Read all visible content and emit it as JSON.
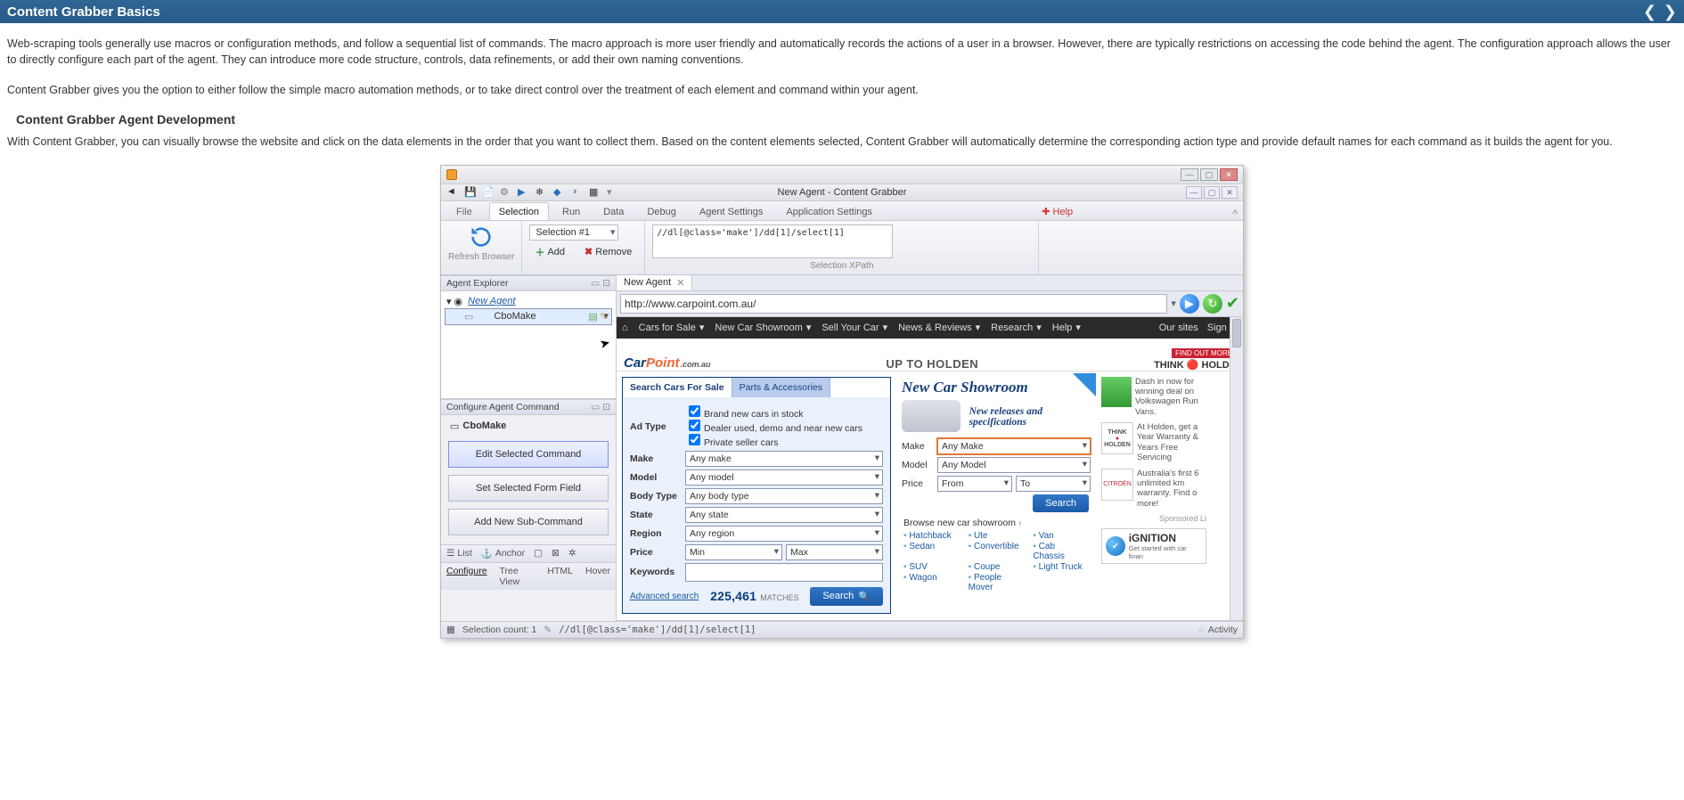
{
  "header": {
    "title": "Content Grabber Basics"
  },
  "paragraphs": {
    "p1": "Web-scraping tools generally use macros or configuration methods, and follow a sequential list of commands. The macro approach is more user friendly and automatically records the actions of a user in a browser. However, there are typically restrictions on accessing the code behind the agent. The configuration approach allows the user to directly configure each part of the agent. They can introduce more code structure, controls, data refinements, or add their own naming conventions.",
    "p2": "Content Grabber gives you the option to either follow the simple macro automation methods, or to take direct control over the treatment of each element and command within your agent.",
    "h2": "Content Grabber Agent Development",
    "p3": "With Content Grabber, you can visually browse the website and click on the data elements in the order that you want to collect them. Based on the content elements selected, Content Grabber will automatically determine the corresponding action type and provide default names for each command as it builds the agent for you."
  },
  "app": {
    "qa_title": "New Agent - Content Grabber",
    "tabs": {
      "file": "File",
      "selection": "Selection",
      "run": "Run",
      "data": "Data",
      "debug": "Debug",
      "agent_settings": "Agent Settings",
      "app_settings": "Application Settings",
      "help": "Help"
    },
    "refresh": "Refresh Browser",
    "selection_combo": "Selection #1",
    "add": "Add",
    "remove": "Remove",
    "xpath": "//dl[@class='make']/dd[1]/select[1]",
    "xpath_label": "Selection XPath",
    "explorer": {
      "title": "Agent Explorer",
      "root": "New Agent",
      "child": "CboMake"
    },
    "configure": {
      "title": "Configure Agent Command",
      "cmd": "CboMake",
      "b1": "Edit Selected Command",
      "b2": "Set Selected Form Field",
      "b3": "Add New Sub-Command"
    },
    "toolrow": {
      "list": "List",
      "anchor": "Anchor"
    },
    "tabrow": {
      "configure": "Configure",
      "tree": "Tree View",
      "html": "HTML",
      "hover": "Hover"
    },
    "doc_tab": "New Agent",
    "url": "http://www.carpoint.com.au/",
    "status_count": "Selection count: 1",
    "status_xpath": "//dl[@class='make']/dd[1]/select[1]",
    "activity": "Activity"
  },
  "site": {
    "nav": {
      "cars": "Cars for Sale",
      "new": "New Car Showroom",
      "sell": "Sell Your Car",
      "news": "News & Reviews",
      "research": "Research",
      "help": "Help",
      "our": "Our sites",
      "sign": "Sign In"
    },
    "banner_mid": "UP TO HOLDEN",
    "banner_r": "THINK 🔴 HOLDE",
    "banner_find": "FIND OUT MORE",
    "search": {
      "t1": "Search Cars For Sale",
      "t2": "Parts & Accessories",
      "adtype": "Ad Type",
      "c1": "Brand new cars in stock",
      "c2": "Dealer used, demo and near new cars",
      "c3": "Private seller cars",
      "make": "Make",
      "make_v": "Any make",
      "model": "Model",
      "model_v": "Any model",
      "body": "Body Type",
      "body_v": "Any body type",
      "state": "State",
      "state_v": "Any state",
      "region": "Region",
      "region_v": "Any region",
      "price": "Price",
      "price_min": "Min",
      "price_max": "Max",
      "keywords": "Keywords",
      "adv": "Advanced search",
      "matches": "225,461",
      "matches_l": "MATCHES",
      "search_btn": "Search"
    },
    "mid": {
      "title": "New Car Showroom",
      "sub": "New releases and specifications",
      "make": "Make",
      "make_v": "Any Make",
      "model": "Model",
      "model_v": "Any Model",
      "price": "Price",
      "price_from": "From",
      "price_to": "To",
      "search": "Search",
      "browse": "Browse new car showroom",
      "links": [
        "Hatchback",
        "Ute",
        "Van",
        "Sedan",
        "Convertible",
        "Cab Chassis",
        "SUV",
        "Coupe",
        "Light Truck",
        "Wagon",
        "People Mover"
      ]
    },
    "ads": {
      "a1": "Dash in now for winning deal on Volkswagen Run Vans.",
      "a2": "At Holden, get a Year Warranty & Years Free Servicing",
      "a3": "Australia's first 6 unlimited km warranty. Find o more!",
      "a4": "Sponsored Li",
      "think": "THINK",
      "holden": "HOLDEN",
      "ign": "iGNITION",
      "ign_s": "Get started with car finan"
    }
  }
}
